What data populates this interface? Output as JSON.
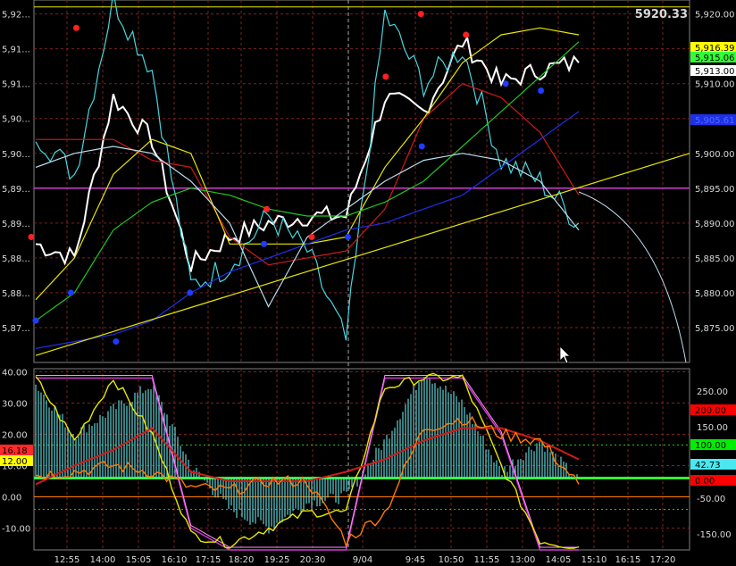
{
  "colors": {
    "background": "#000000",
    "grid": "#7a2222",
    "frame": "#808080",
    "axis_text": "#d8d8d8",
    "price": "#ffffff",
    "cyan": "#49d6dc",
    "red": "#d01a1a",
    "yellow": "#e6e600",
    "green": "#22c522",
    "blue": "#1f2fe8",
    "magenta": "#d23ad2",
    "lightblue": "#b8ddf0",
    "orange": "#ff7a00",
    "osc_green": "#33ff33",
    "hist": "#5fd1d6",
    "pink": "#ff8cff"
  },
  "header_value": "5920.33",
  "xticks": [
    "12:55",
    "14:00",
    "15:05",
    "16:10",
    "17:15",
    "18:20",
    "19:25",
    "20:30",
    "9/04",
    "9:45",
    "10:50",
    "11:55",
    "13:00",
    "14:05",
    "15:10",
    "16:15",
    "17:20"
  ],
  "upper_left_ticks": [
    "5,92...",
    "5,91...",
    "5,91...",
    "5,90...",
    "5,90...",
    "5,89...",
    "5,89...",
    "5,88...",
    "5,88...",
    "5,87..."
  ],
  "upper_right_ticks": [
    "5,920.00",
    "5,915.00",
    "5,910.00",
    "5,905.00",
    "5,900.00",
    "5,895.00",
    "5,890.00",
    "5,885.00",
    "5,880.00",
    "5,875.00"
  ],
  "upper_badges": [
    {
      "text": "5,916.39",
      "bg": "#ffff00",
      "fg": "#000000",
      "value": 5916.39
    },
    {
      "text": "5,915.06",
      "bg": "#33ff33",
      "fg": "#000000",
      "value": 5915.06
    },
    {
      "text": "5,913.00",
      "bg": "#ffffff",
      "fg": "#000000",
      "value": 5913.0
    },
    {
      "text": "5,905.61",
      "bg": "#1f2fe8",
      "fg": "#4c6cff",
      "value": 5905.61
    }
  ],
  "lower_left_ticks": [
    "40.00",
    "30.00",
    "20.00",
    "10.00",
    "0.00",
    "-10.00"
  ],
  "lower_right_ticks": [
    "250.00",
    "150.00",
    "50.00",
    "-50.00",
    "-150.00"
  ],
  "lower_left_badges": [
    {
      "text": "16.18",
      "bg": "#ff2a2a",
      "fg": "#000000",
      "value": 16.18
    },
    {
      "text": "12.00",
      "bg": "#ffff00",
      "fg": "#000000",
      "value": 12.0
    }
  ],
  "lower_right_badges": [
    {
      "text": "200.00",
      "bg": "#ff0000",
      "fg": "#000000",
      "value": 200
    },
    {
      "text": "100.00",
      "bg": "#00ee00",
      "fg": "#000000",
      "value": 100
    },
    {
      "text": "42.73",
      "bg": "#49e8f0",
      "fg": "#000000",
      "value": 42.73
    },
    {
      "text": "0.00",
      "bg": "#ff0000",
      "fg": "#000000",
      "value": 0
    }
  ],
  "chart_data": [
    {
      "type": "line",
      "x": [
        "12:55",
        "14:00",
        "15:05",
        "16:10",
        "17:15",
        "18:20",
        "19:25",
        "20:30",
        "9/04",
        "9:45",
        "10:50",
        "11:55",
        "13:00",
        "14:05",
        "15:10"
      ],
      "ylim": [
        5870,
        5922
      ],
      "series": [
        {
          "color": "white",
          "values": [
            5887,
            5885,
            5908,
            5902,
            5884,
            5888,
            5890,
            5891,
            5891,
            5908,
            5906,
            5916,
            5910,
            5912,
            5913
          ]
        },
        {
          "color": "cyan",
          "values": [
            5903,
            5897,
            5922,
            5912,
            5881,
            5884,
            5891,
            5886,
            5873,
            5920,
            5910,
            5915,
            5899,
            5896,
            5890
          ]
        },
        {
          "color": "red",
          "values": [
            5902,
            5902,
            5902,
            5899,
            5898,
            5888,
            5884,
            5885,
            5886,
            5892,
            5905,
            5910,
            5908,
            5903,
            5894
          ]
        },
        {
          "color": "yellow",
          "values": [
            5879,
            5885,
            5897,
            5902,
            5900,
            5887,
            5887,
            5887,
            5888,
            5898,
            5905,
            5913,
            5917,
            5918,
            5917
          ]
        },
        {
          "color": "green",
          "values": [
            5876,
            5880,
            5889,
            5893,
            5895,
            5894,
            5892,
            5891,
            5891,
            5893,
            5896,
            5901,
            5906,
            5911,
            5916
          ]
        },
        {
          "color": "blue",
          "values": [
            5872,
            5873,
            5874,
            5876,
            5880,
            5883,
            5885,
            5887,
            5889,
            5890,
            5892,
            5894,
            5898,
            5902,
            5906
          ]
        },
        {
          "color": "lightblue",
          "values": [
            5898,
            5900,
            5901,
            5900,
            5896,
            5890,
            5878,
            5888,
            5892,
            5896,
            5899,
            5900,
            5899,
            5896,
            5889
          ]
        },
        {
          "color": "yellow",
          "name_hint": "trendline",
          "values": [
            5871,
            5872,
            5874,
            5876,
            5878,
            5879,
            5881,
            5883,
            5885,
            5886,
            5888,
            5890,
            5892,
            5894,
            5896
          ]
        }
      ],
      "horizontal_lines": [
        5895,
        5921
      ],
      "dots": [
        {
          "x": "12:55",
          "y": 5888,
          "color": "red"
        },
        {
          "x": "14:00",
          "y": 5918,
          "color": "red"
        },
        {
          "x": "19:25",
          "y": 5892,
          "color": "red"
        },
        {
          "x": "20:30",
          "y": 5888,
          "color": "red"
        },
        {
          "x": "9:45",
          "y": 5911,
          "color": "red"
        },
        {
          "x": "10:50",
          "y": 5920,
          "color": "red"
        },
        {
          "x": "11:55",
          "y": 5917,
          "color": "red"
        },
        {
          "x": "12:55",
          "y": 5876,
          "color": "blue"
        },
        {
          "x": "14:00",
          "y": 5880,
          "color": "blue"
        },
        {
          "x": "15:05",
          "y": 5873,
          "color": "blue"
        },
        {
          "x": "17:15",
          "y": 5880,
          "color": "blue"
        },
        {
          "x": "19:25",
          "y": 5887,
          "color": "blue"
        },
        {
          "x": "9/04",
          "y": 5888,
          "color": "blue"
        },
        {
          "x": "10:50",
          "y": 5901,
          "color": "blue"
        },
        {
          "x": "13:00",
          "y": 5910,
          "color": "blue"
        },
        {
          "x": "14:05",
          "y": 5909,
          "color": "blue"
        }
      ]
    },
    {
      "type": "bar",
      "ylim": [
        -17,
        41
      ],
      "series": [
        {
          "color": "cyan",
          "kind": "histogram",
          "values": [
            36,
            20,
            28,
            36,
            10,
            -4,
            -10,
            -2,
            0,
            18,
            40,
            30,
            8,
            18,
            5
          ]
        },
        {
          "color": "magenta",
          "values": [
            38,
            38,
            38,
            38,
            -10,
            -17,
            -17,
            -17,
            -17,
            38,
            38,
            38,
            20,
            -17,
            -17
          ]
        },
        {
          "color": "yellow",
          "values": [
            38,
            18,
            38,
            20,
            -12,
            -15,
            -10,
            -5,
            -5,
            35,
            38,
            38,
            10,
            -14,
            -16
          ]
        },
        {
          "color": "red",
          "values": [
            4,
            10,
            15,
            22,
            8,
            5,
            5,
            5,
            8,
            12,
            18,
            22,
            22,
            18,
            12
          ]
        },
        {
          "color": "orange",
          "values": [
            7,
            8,
            10,
            8,
            3,
            2,
            5,
            5,
            -14,
            -5,
            22,
            25,
            20,
            18,
            4
          ]
        }
      ],
      "horizontal_lines": [
        0,
        20,
        6,
        -4
      ]
    }
  ]
}
